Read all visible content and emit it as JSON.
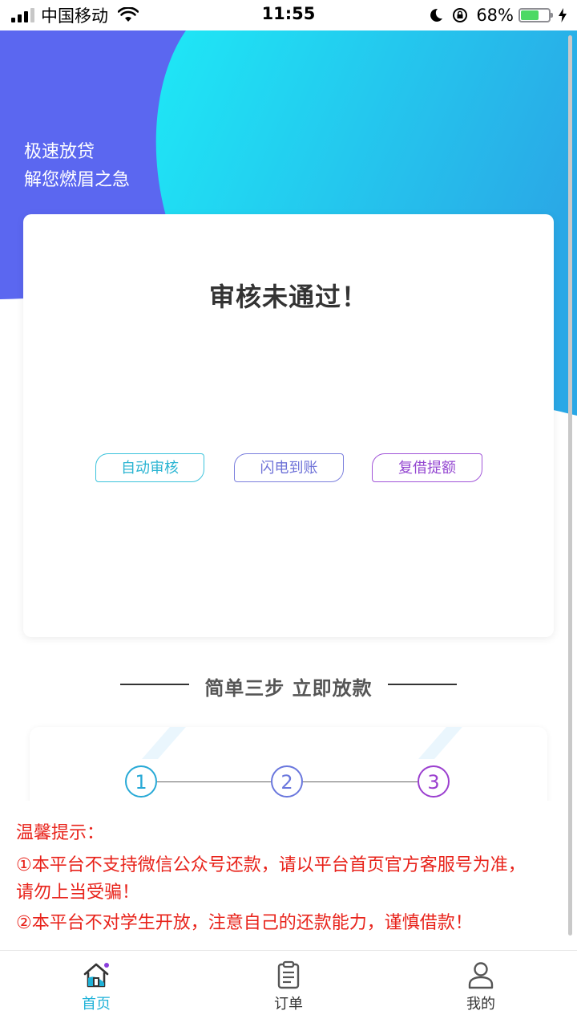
{
  "status_bar": {
    "carrier": "中国移动",
    "time": "11:55",
    "battery_percent": "68%",
    "battery_level": 0.68
  },
  "banner": {
    "slogan_line1": "极速放贷",
    "slogan_line2": "解您燃眉之急",
    "colors": {
      "purple": "#5b67f0",
      "cyan": "#1ee6f6",
      "blue": "#2aaee6"
    }
  },
  "status_card": {
    "title": "审核未通过！",
    "tags": [
      "自动审核",
      "闪电到账",
      "复借提额"
    ]
  },
  "steps_section": {
    "title": "简单三步  立即放款",
    "steps": [
      "1",
      "2",
      "3"
    ]
  },
  "tips": {
    "heading": "温馨提示：",
    "line1": "①本平台不支持微信公众号还款，请以平台首页官方客服号为准，",
    "line2": "请勿上当受骗！",
    "line3": "②本平台不对学生开放，注意自己的还款能力，谨慎借款！",
    "color": "#e8231b"
  },
  "tab_bar": {
    "active": "home",
    "tabs": [
      {
        "label": "首页",
        "icon": "home-icon"
      },
      {
        "label": "订单",
        "icon": "clipboard-icon"
      },
      {
        "label": "我的",
        "icon": "person-icon"
      }
    ],
    "active_color": "#1fb2d8"
  }
}
